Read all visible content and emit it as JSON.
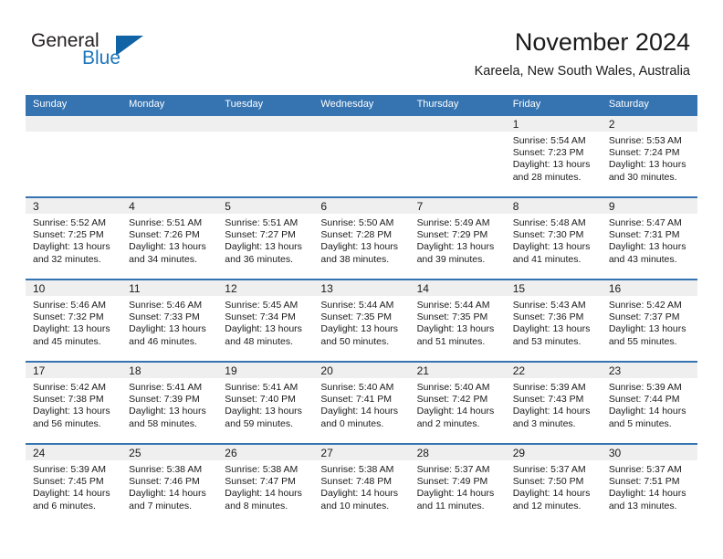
{
  "logo": {
    "word1": "General",
    "word2": "Blue",
    "accent_color": "#1d76bc",
    "triangle_color": "#1063a4"
  },
  "header": {
    "title": "November 2024",
    "subtitle": "Kareela, New South Wales, Australia"
  },
  "theme": {
    "header_blue": "#3573b1",
    "day_band_gray": "#efefef",
    "text_color": "#1a1a1a"
  },
  "weekdays": [
    "Sunday",
    "Monday",
    "Tuesday",
    "Wednesday",
    "Thursday",
    "Friday",
    "Saturday"
  ],
  "weeks": [
    [
      {
        "day": "",
        "sunrise": "",
        "sunset": "",
        "daylight1": "",
        "daylight2": ""
      },
      {
        "day": "",
        "sunrise": "",
        "sunset": "",
        "daylight1": "",
        "daylight2": ""
      },
      {
        "day": "",
        "sunrise": "",
        "sunset": "",
        "daylight1": "",
        "daylight2": ""
      },
      {
        "day": "",
        "sunrise": "",
        "sunset": "",
        "daylight1": "",
        "daylight2": ""
      },
      {
        "day": "",
        "sunrise": "",
        "sunset": "",
        "daylight1": "",
        "daylight2": ""
      },
      {
        "day": "1",
        "sunrise": "Sunrise: 5:54 AM",
        "sunset": "Sunset: 7:23 PM",
        "daylight1": "Daylight: 13 hours",
        "daylight2": "and 28 minutes."
      },
      {
        "day": "2",
        "sunrise": "Sunrise: 5:53 AM",
        "sunset": "Sunset: 7:24 PM",
        "daylight1": "Daylight: 13 hours",
        "daylight2": "and 30 minutes."
      }
    ],
    [
      {
        "day": "3",
        "sunrise": "Sunrise: 5:52 AM",
        "sunset": "Sunset: 7:25 PM",
        "daylight1": "Daylight: 13 hours",
        "daylight2": "and 32 minutes."
      },
      {
        "day": "4",
        "sunrise": "Sunrise: 5:51 AM",
        "sunset": "Sunset: 7:26 PM",
        "daylight1": "Daylight: 13 hours",
        "daylight2": "and 34 minutes."
      },
      {
        "day": "5",
        "sunrise": "Sunrise: 5:51 AM",
        "sunset": "Sunset: 7:27 PM",
        "daylight1": "Daylight: 13 hours",
        "daylight2": "and 36 minutes."
      },
      {
        "day": "6",
        "sunrise": "Sunrise: 5:50 AM",
        "sunset": "Sunset: 7:28 PM",
        "daylight1": "Daylight: 13 hours",
        "daylight2": "and 38 minutes."
      },
      {
        "day": "7",
        "sunrise": "Sunrise: 5:49 AM",
        "sunset": "Sunset: 7:29 PM",
        "daylight1": "Daylight: 13 hours",
        "daylight2": "and 39 minutes."
      },
      {
        "day": "8",
        "sunrise": "Sunrise: 5:48 AM",
        "sunset": "Sunset: 7:30 PM",
        "daylight1": "Daylight: 13 hours",
        "daylight2": "and 41 minutes."
      },
      {
        "day": "9",
        "sunrise": "Sunrise: 5:47 AM",
        "sunset": "Sunset: 7:31 PM",
        "daylight1": "Daylight: 13 hours",
        "daylight2": "and 43 minutes."
      }
    ],
    [
      {
        "day": "10",
        "sunrise": "Sunrise: 5:46 AM",
        "sunset": "Sunset: 7:32 PM",
        "daylight1": "Daylight: 13 hours",
        "daylight2": "and 45 minutes."
      },
      {
        "day": "11",
        "sunrise": "Sunrise: 5:46 AM",
        "sunset": "Sunset: 7:33 PM",
        "daylight1": "Daylight: 13 hours",
        "daylight2": "and 46 minutes."
      },
      {
        "day": "12",
        "sunrise": "Sunrise: 5:45 AM",
        "sunset": "Sunset: 7:34 PM",
        "daylight1": "Daylight: 13 hours",
        "daylight2": "and 48 minutes."
      },
      {
        "day": "13",
        "sunrise": "Sunrise: 5:44 AM",
        "sunset": "Sunset: 7:35 PM",
        "daylight1": "Daylight: 13 hours",
        "daylight2": "and 50 minutes."
      },
      {
        "day": "14",
        "sunrise": "Sunrise: 5:44 AM",
        "sunset": "Sunset: 7:35 PM",
        "daylight1": "Daylight: 13 hours",
        "daylight2": "and 51 minutes."
      },
      {
        "day": "15",
        "sunrise": "Sunrise: 5:43 AM",
        "sunset": "Sunset: 7:36 PM",
        "daylight1": "Daylight: 13 hours",
        "daylight2": "and 53 minutes."
      },
      {
        "day": "16",
        "sunrise": "Sunrise: 5:42 AM",
        "sunset": "Sunset: 7:37 PM",
        "daylight1": "Daylight: 13 hours",
        "daylight2": "and 55 minutes."
      }
    ],
    [
      {
        "day": "17",
        "sunrise": "Sunrise: 5:42 AM",
        "sunset": "Sunset: 7:38 PM",
        "daylight1": "Daylight: 13 hours",
        "daylight2": "and 56 minutes."
      },
      {
        "day": "18",
        "sunrise": "Sunrise: 5:41 AM",
        "sunset": "Sunset: 7:39 PM",
        "daylight1": "Daylight: 13 hours",
        "daylight2": "and 58 minutes."
      },
      {
        "day": "19",
        "sunrise": "Sunrise: 5:41 AM",
        "sunset": "Sunset: 7:40 PM",
        "daylight1": "Daylight: 13 hours",
        "daylight2": "and 59 minutes."
      },
      {
        "day": "20",
        "sunrise": "Sunrise: 5:40 AM",
        "sunset": "Sunset: 7:41 PM",
        "daylight1": "Daylight: 14 hours",
        "daylight2": "and 0 minutes."
      },
      {
        "day": "21",
        "sunrise": "Sunrise: 5:40 AM",
        "sunset": "Sunset: 7:42 PM",
        "daylight1": "Daylight: 14 hours",
        "daylight2": "and 2 minutes."
      },
      {
        "day": "22",
        "sunrise": "Sunrise: 5:39 AM",
        "sunset": "Sunset: 7:43 PM",
        "daylight1": "Daylight: 14 hours",
        "daylight2": "and 3 minutes."
      },
      {
        "day": "23",
        "sunrise": "Sunrise: 5:39 AM",
        "sunset": "Sunset: 7:44 PM",
        "daylight1": "Daylight: 14 hours",
        "daylight2": "and 5 minutes."
      }
    ],
    [
      {
        "day": "24",
        "sunrise": "Sunrise: 5:39 AM",
        "sunset": "Sunset: 7:45 PM",
        "daylight1": "Daylight: 14 hours",
        "daylight2": "and 6 minutes."
      },
      {
        "day": "25",
        "sunrise": "Sunrise: 5:38 AM",
        "sunset": "Sunset: 7:46 PM",
        "daylight1": "Daylight: 14 hours",
        "daylight2": "and 7 minutes."
      },
      {
        "day": "26",
        "sunrise": "Sunrise: 5:38 AM",
        "sunset": "Sunset: 7:47 PM",
        "daylight1": "Daylight: 14 hours",
        "daylight2": "and 8 minutes."
      },
      {
        "day": "27",
        "sunrise": "Sunrise: 5:38 AM",
        "sunset": "Sunset: 7:48 PM",
        "daylight1": "Daylight: 14 hours",
        "daylight2": "and 10 minutes."
      },
      {
        "day": "28",
        "sunrise": "Sunrise: 5:37 AM",
        "sunset": "Sunset: 7:49 PM",
        "daylight1": "Daylight: 14 hours",
        "daylight2": "and 11 minutes."
      },
      {
        "day": "29",
        "sunrise": "Sunrise: 5:37 AM",
        "sunset": "Sunset: 7:50 PM",
        "daylight1": "Daylight: 14 hours",
        "daylight2": "and 12 minutes."
      },
      {
        "day": "30",
        "sunrise": "Sunrise: 5:37 AM",
        "sunset": "Sunset: 7:51 PM",
        "daylight1": "Daylight: 14 hours",
        "daylight2": "and 13 minutes."
      }
    ]
  ]
}
